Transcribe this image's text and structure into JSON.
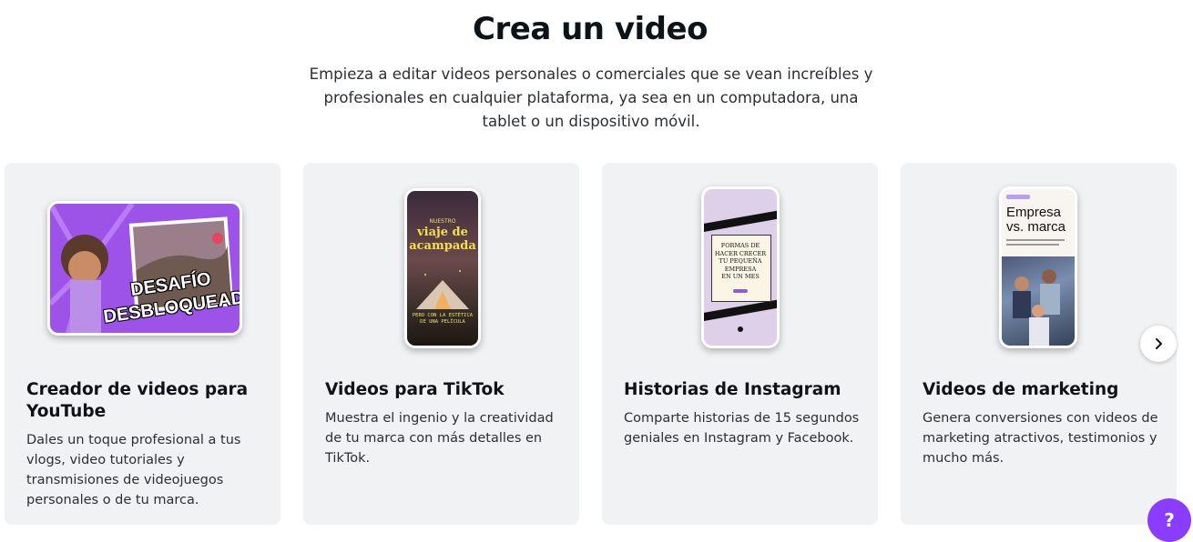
{
  "header": {
    "title": "Crea un video",
    "subtitle": "Empieza a editar videos personales o comerciales que se vean increíbles y profesionales en cualquier plataforma, ya sea en un computadora, una tablet o un dispositivo móvil."
  },
  "cards": [
    {
      "title": "Creador de videos para YouTube",
      "description": "Dales un toque profesional a tus vlogs, video tutoriales y transmisiones de videojuegos personales o de tu marca.",
      "thumb": {
        "line1": "DESAFÍO",
        "line2": "DESBLOQUEADO"
      }
    },
    {
      "title": "Videos para TikTok",
      "description": "Muestra el ingenio y la creatividad de tu marca con más detalles en TikTok.",
      "thumb": {
        "small": "NUESTRO",
        "line1": "viaje de",
        "line2": "acampada",
        "caption1": "PERO CON LA ESTÉTICA",
        "caption2": "DE UNA PELÍCULA"
      }
    },
    {
      "title": "Historias de Instagram",
      "description": "Comparte historias de 15 segundos geniales en Instagram y Facebook.",
      "thumb": {
        "text": [
          "FORMAS DE",
          "HACER CRECER",
          "TU PEQUEÑA",
          "EMPRESA",
          "EN UN MES"
        ]
      }
    },
    {
      "title": "Videos de marketing",
      "description": "Genera conversiones con videos de marketing atractivos, testimonios y mucho más.",
      "thumb": {
        "line1": "Empresa",
        "line2": "vs. marca"
      }
    }
  ],
  "buttons": {
    "help": "?"
  },
  "colors": {
    "accent": "#8b3dff",
    "card_bg": "#f1f2f4"
  }
}
